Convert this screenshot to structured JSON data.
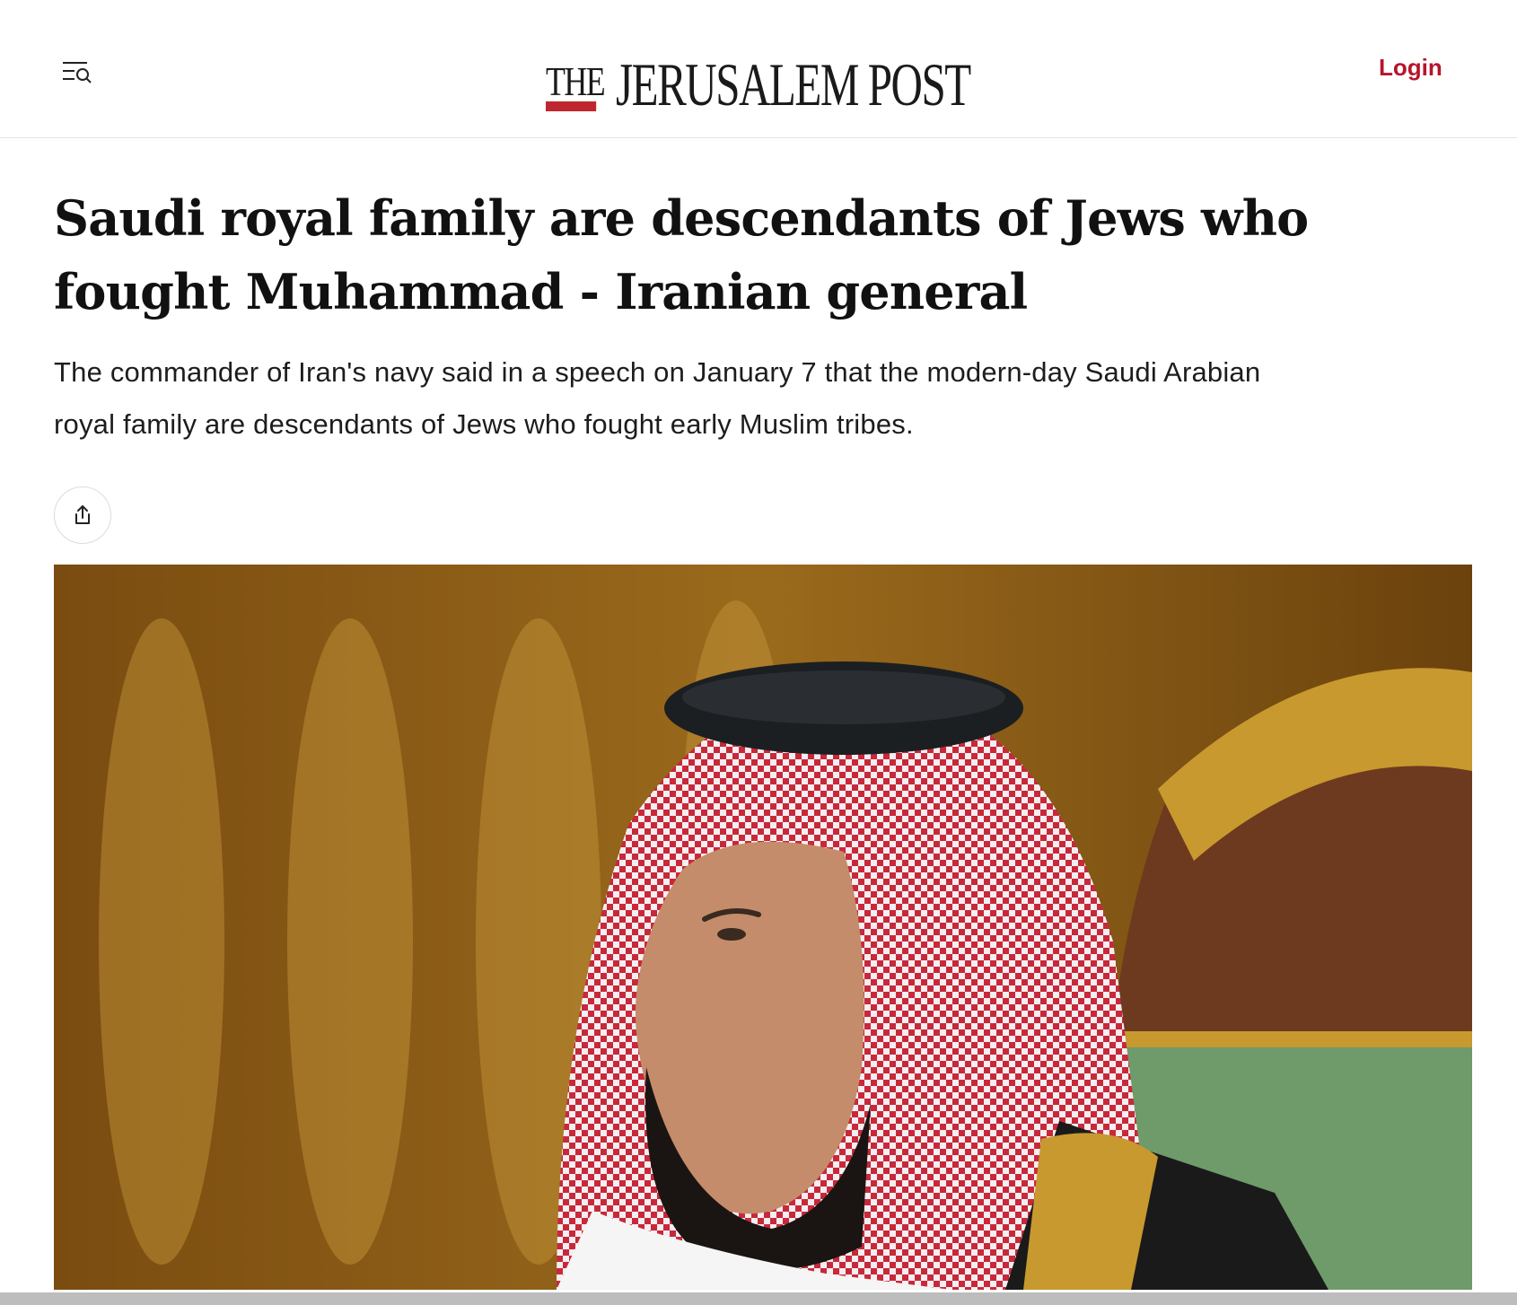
{
  "header": {
    "menu_icon": "menu-search-icon",
    "logo_the": "THE",
    "logo_main": "JERUSALEM POST",
    "login_label": "Login"
  },
  "article": {
    "headline": "Saudi royal family are descendants of Jews who fought Muhammad - Iranian general",
    "subhead": "The commander of Iran's navy said in a speech on January 7 that the modern-day Saudi Arabian royal family are descendants of Jews who fought early Muslim tribes.",
    "share_icon": "share-icon"
  },
  "colors": {
    "brand_red": "#b7142b",
    "logo_bar": "#c0262d",
    "text": "#111111"
  }
}
